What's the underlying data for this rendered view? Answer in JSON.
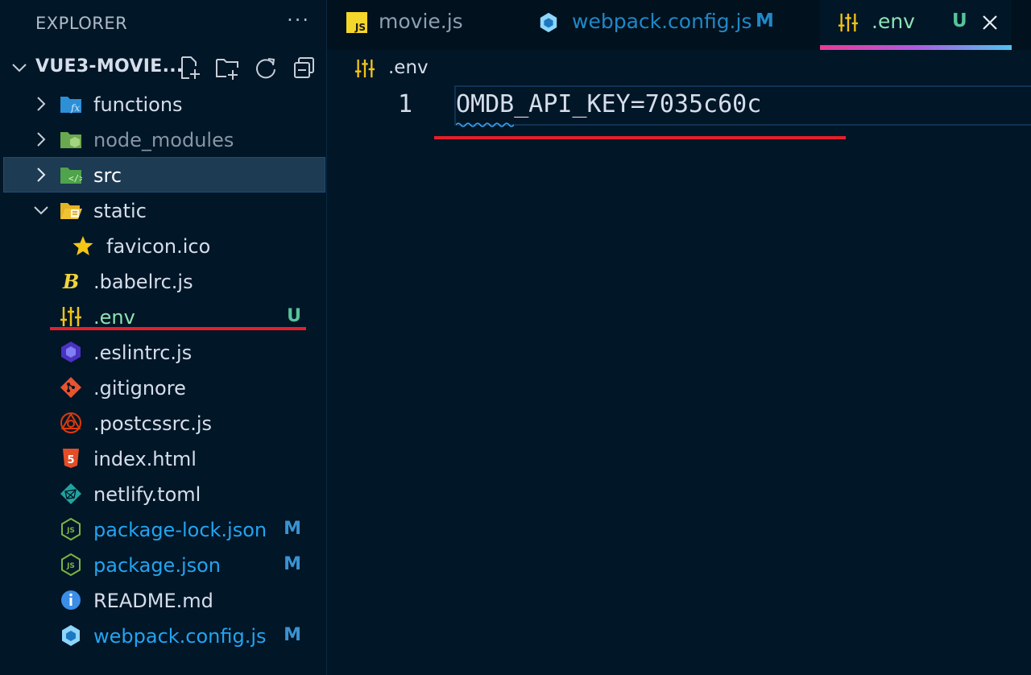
{
  "explorer": {
    "title": "EXPLORER",
    "more_label": "···",
    "project_name": "VUE3-MOVIE...",
    "items": [
      {
        "label": "functions",
        "status": ""
      },
      {
        "label": "node_modules",
        "status": ""
      },
      {
        "label": "src",
        "status": ""
      },
      {
        "label": "static",
        "status": ""
      },
      {
        "label": "favicon.ico",
        "status": ""
      },
      {
        "label": ".babelrc.js",
        "status": ""
      },
      {
        "label": ".env",
        "status": "U"
      },
      {
        "label": ".eslintrc.js",
        "status": ""
      },
      {
        "label": ".gitignore",
        "status": ""
      },
      {
        "label": ".postcssrc.js",
        "status": ""
      },
      {
        "label": "index.html",
        "status": ""
      },
      {
        "label": "netlify.toml",
        "status": ""
      },
      {
        "label": "package-lock.json",
        "status": "M"
      },
      {
        "label": "package.json",
        "status": "M"
      },
      {
        "label": "README.md",
        "status": ""
      },
      {
        "label": "webpack.config.js",
        "status": "M"
      }
    ]
  },
  "tabs": [
    {
      "label": "movie.js",
      "icon": "js-icon",
      "status": ""
    },
    {
      "label": "webpack.config.js",
      "icon": "webpack-icon",
      "status": "M"
    },
    {
      "label": ".env",
      "icon": "env-settings-icon",
      "status": "U",
      "active": true
    }
  ],
  "breadcrumb": {
    "label": ".env"
  },
  "editor": {
    "line_number": "1",
    "line_text": "OMDB_API_KEY=7035c60c"
  },
  "colors": {
    "background": "#011627",
    "annotation_red": "#e5202b",
    "untracked": "#57c49a",
    "modified": "#3a93d1"
  }
}
